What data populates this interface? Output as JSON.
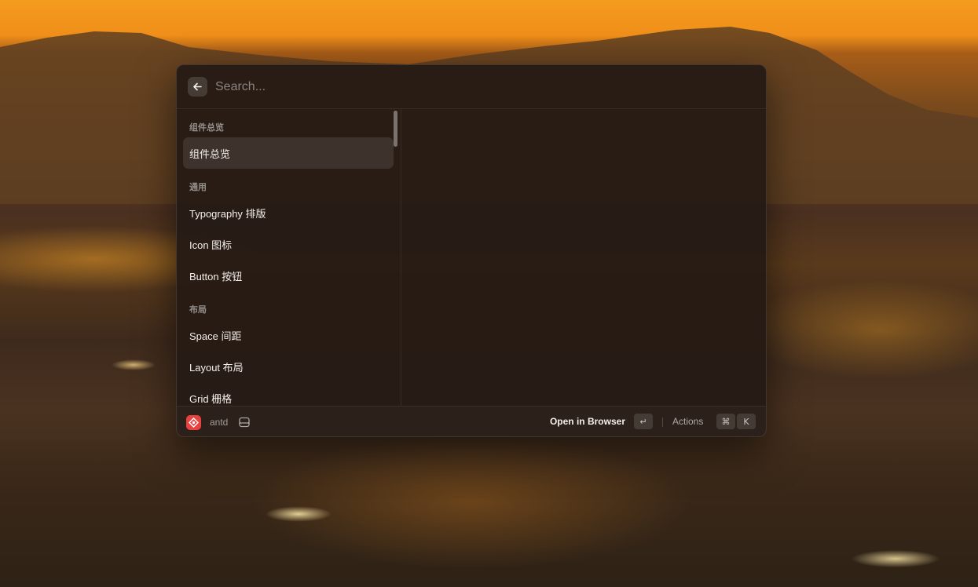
{
  "search": {
    "placeholder": "Search...",
    "value": ""
  },
  "list": {
    "sections": [
      {
        "title": "组件总览",
        "items": [
          {
            "label": "组件总览",
            "selected": true
          }
        ]
      },
      {
        "title": "通用",
        "items": [
          {
            "label": "Typography 排版"
          },
          {
            "label": "Icon 图标"
          },
          {
            "label": "Button 按钮"
          }
        ]
      },
      {
        "title": "布局",
        "items": [
          {
            "label": "Space 间距"
          },
          {
            "label": "Layout 布局"
          },
          {
            "label": "Grid 栅格"
          }
        ]
      }
    ]
  },
  "footer": {
    "extension_name": "antd",
    "primary_action": "Open in Browser",
    "primary_action_key": "↵",
    "actions_label": "Actions",
    "actions_keys": [
      "⌘",
      "K"
    ]
  },
  "colors": {
    "window_bg": "#261b15",
    "extension_icon": "#e8413f",
    "text": "#f4efeb"
  },
  "icons": {
    "back": "arrow-left-icon",
    "extension": "antd-extension-icon",
    "window": "window-layout-icon"
  }
}
